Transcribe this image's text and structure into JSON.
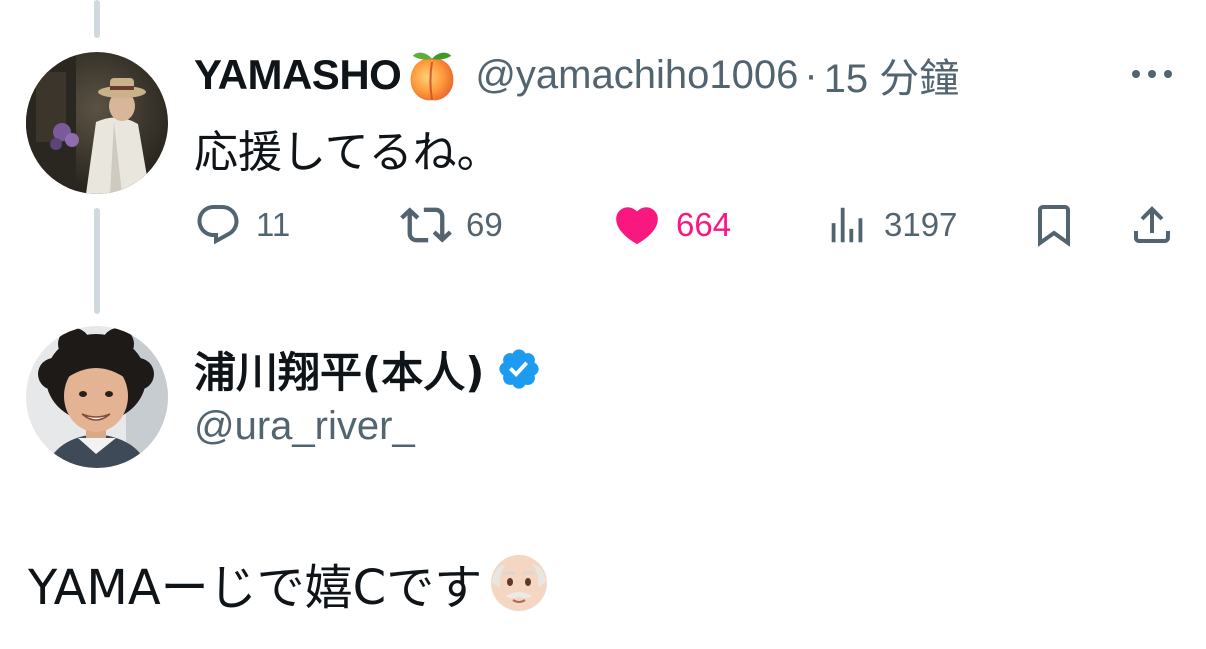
{
  "reply_tweet": {
    "display_name": "YAMASHO",
    "name_emoji": "peach-emoji",
    "handle": "@yamachiho1006",
    "separator": "·",
    "timestamp": "15 分鐘",
    "text": "応援してるね。",
    "actions": {
      "replies": "11",
      "retweets": "69",
      "likes": "664",
      "views": "3197"
    },
    "liked": true
  },
  "main_tweet": {
    "display_name": "浦川翔平(本人)",
    "verified": true,
    "handle": "@ura_river_",
    "text": "YAMAーじで嬉Cです",
    "text_emoji": "old-man-emoji"
  },
  "colors": {
    "text_primary": "#0f1419",
    "text_secondary": "#536471",
    "like_pink": "#f91880",
    "verified_blue": "#1d9bf0",
    "thread_line": "#cfd9de"
  }
}
